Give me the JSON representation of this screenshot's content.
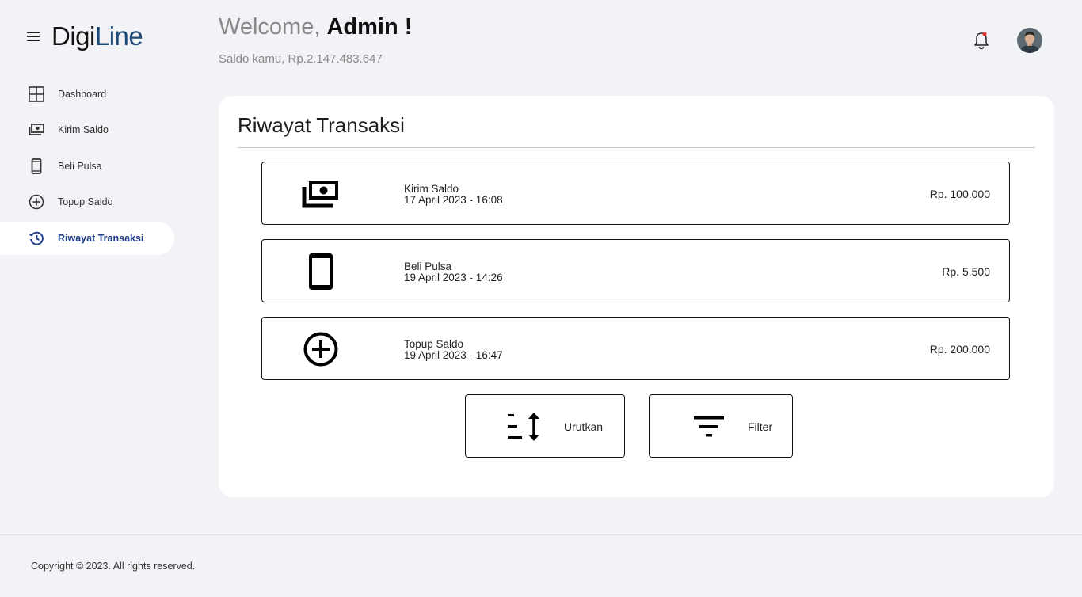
{
  "brand": {
    "logo_part1": "Digi",
    "logo_part2": "Line",
    "menu_icon": "hamburger-icon"
  },
  "sidebar": {
    "items": [
      {
        "label": "Dashboard",
        "icon": "grid-icon",
        "active": false
      },
      {
        "label": "Kirim Saldo",
        "icon": "money-icon",
        "active": false
      },
      {
        "label": "Beli Pulsa",
        "icon": "phone-icon",
        "active": false
      },
      {
        "label": "Topup Saldo",
        "icon": "plus-circle-icon",
        "active": false
      },
      {
        "label": "Riwayat Transaksi",
        "icon": "history-icon",
        "active": true
      }
    ]
  },
  "header": {
    "welcome_prefix": "Welcome, ",
    "user_name": "Admin !",
    "saldo_text": "Saldo kamu, Rp.2.147.483.647",
    "bell_icon": "bell-icon",
    "notification_dot_color": "#e53935"
  },
  "main": {
    "title": "Riwayat Transaksi",
    "transactions": [
      {
        "type": "Kirim Saldo",
        "datetime": "17 April 2023 - 16:08",
        "amount": "Rp. 100.000",
        "icon": "money-icon"
      },
      {
        "type": "Beli Pulsa",
        "datetime": "19 April 2023 - 14:26",
        "amount": "Rp. 5.500",
        "icon": "phone-icon"
      },
      {
        "type": "Topup Saldo",
        "datetime": "19 April 2023 - 16:47",
        "amount": "Rp. 200.000",
        "icon": "plus-circle-icon"
      }
    ],
    "actions": {
      "sort_label": "Urutkan",
      "filter_label": "Filter"
    }
  },
  "footer": {
    "copyright": "Copyright © 2023. All rights reserved."
  },
  "colors": {
    "accent": "#1f3d8a",
    "brand": "#1c4a7a",
    "background": "#f1f3f6"
  }
}
